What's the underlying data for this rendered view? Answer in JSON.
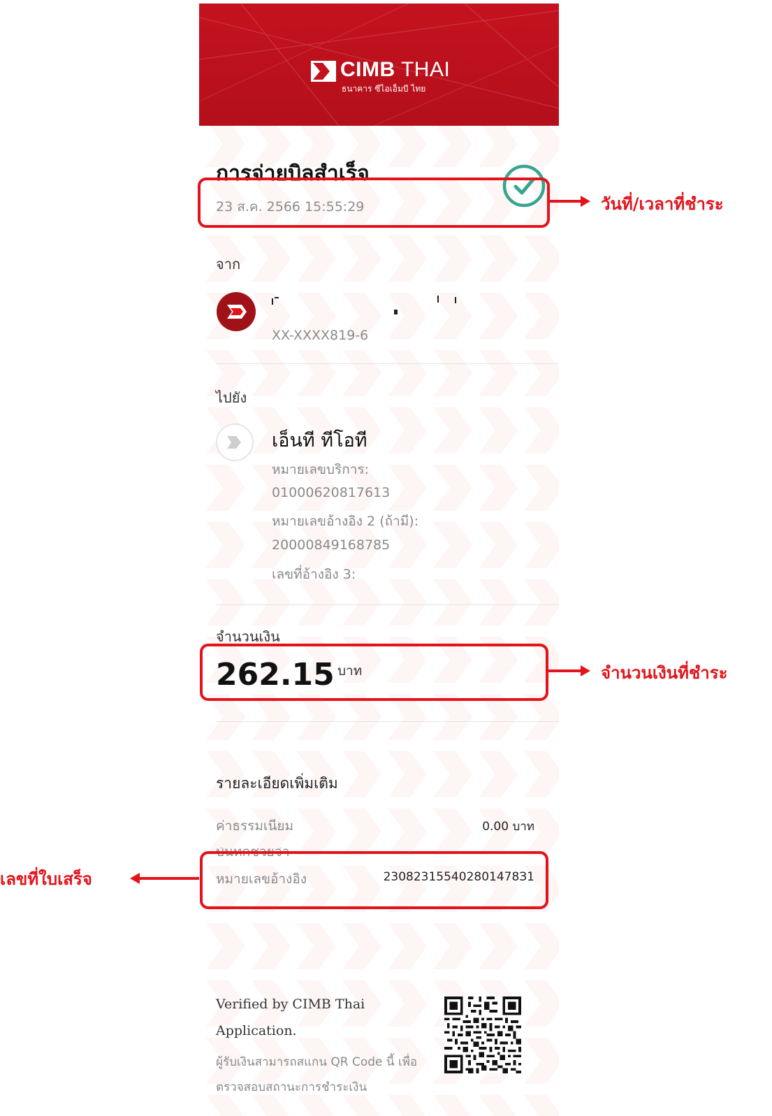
{
  "header": {
    "brand_bold": "CIMB",
    "brand_light": " THAI",
    "brand_sub": "ธนาคาร ซีไอเอ็มบี ไทย"
  },
  "status": {
    "title": "การจ่ายบิลสำเร็จ",
    "datetime": "23 ส.ค. 2566 15:55:29"
  },
  "from": {
    "label": "จาก",
    "account": "XX-XXXX819-6"
  },
  "to": {
    "label": "ไปยัง",
    "biller": "เอ็นที ทีโอที",
    "service_no_label": "หมายเลขบริการ:",
    "service_no": "01000620817613",
    "ref2_label": "หมายเลขอ้างอิง 2 (ถ้ามี):",
    "ref2": "20000849168785",
    "ref3_label": "เลขที่อ้างอิง 3:"
  },
  "amount": {
    "label": "จำนวนเงิน",
    "value": "262.15",
    "unit": "บาท"
  },
  "details": {
    "heading": "รายละเอียดเพิ่มเติม",
    "fee_label": "ค่าธรรมเนียม",
    "fee_value": "0.00 บาท",
    "memo_label": "บันทึกช่วยจำ",
    "ref_label": "หมายเลขอ้างอิง",
    "ref_value": "230823155402801478З1"
  },
  "verify": {
    "line": "Verified by CIMB Thai Application.",
    "note": "ผู้รับเงินสามารถสแกน QR Code นี้ เพื่อตรวจสอบสถานะการชำระเงิน"
  },
  "annotations": {
    "datetime_callout": "วันที่/เวลาที่ชำระ",
    "amount_callout": "จำนวนเงินที่ชำระ",
    "ref_callout": "เลขที่ใบเสร็จ"
  },
  "colors": {
    "brand_red": "#c4121f",
    "success_teal": "#36a58f",
    "annotation_red": "#e3131b"
  }
}
